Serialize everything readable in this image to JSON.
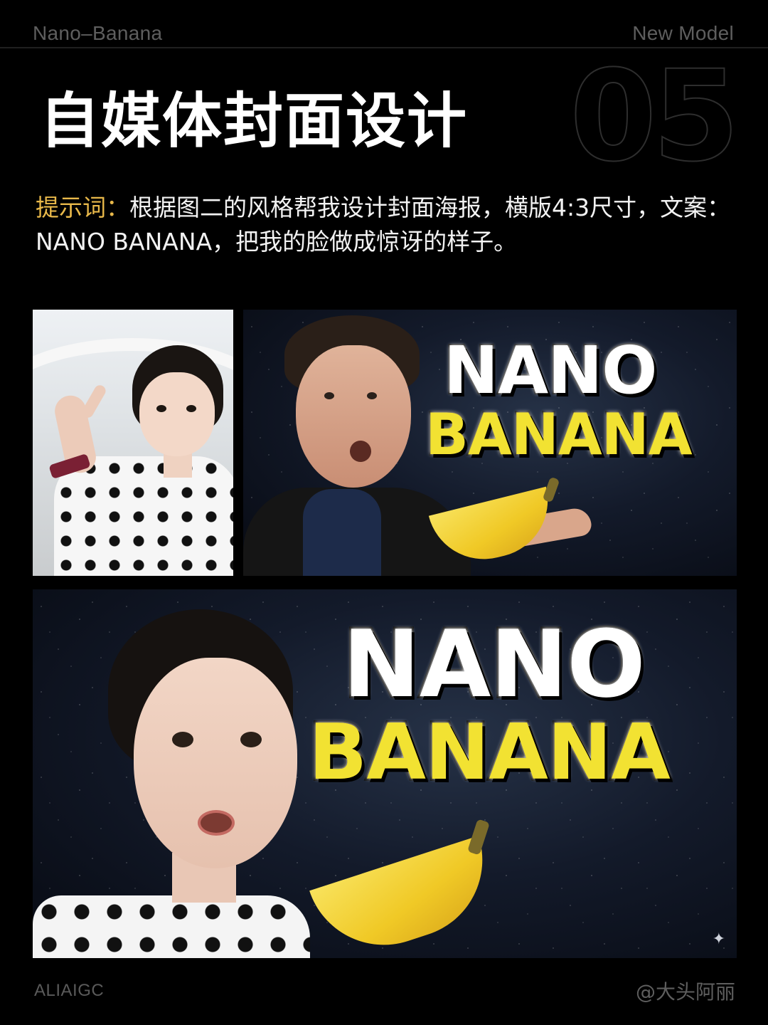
{
  "header": {
    "left_text": "Nano–Banana",
    "right_text": "New Model"
  },
  "section_number": "05",
  "title": "自媒体封面设计",
  "prompt": {
    "label": "提示词：",
    "text": "根据图二的风格帮我设计封面海报，横版4:3尺寸，文案：NANO BANANA，把我的脸做成惊讶的样子。"
  },
  "images": {
    "style_thumbnail": {
      "line1": "NANO",
      "line2": "BANANA"
    },
    "generated_cover": {
      "line1": "NANO",
      "line2": "BANANA"
    }
  },
  "footer": {
    "left_text": "ALIAIGC",
    "right_text": "@大头阿丽"
  },
  "colors": {
    "background": "#000000",
    "prompt_label": "#e8b84a",
    "banana_yellow": "#f2e232"
  }
}
